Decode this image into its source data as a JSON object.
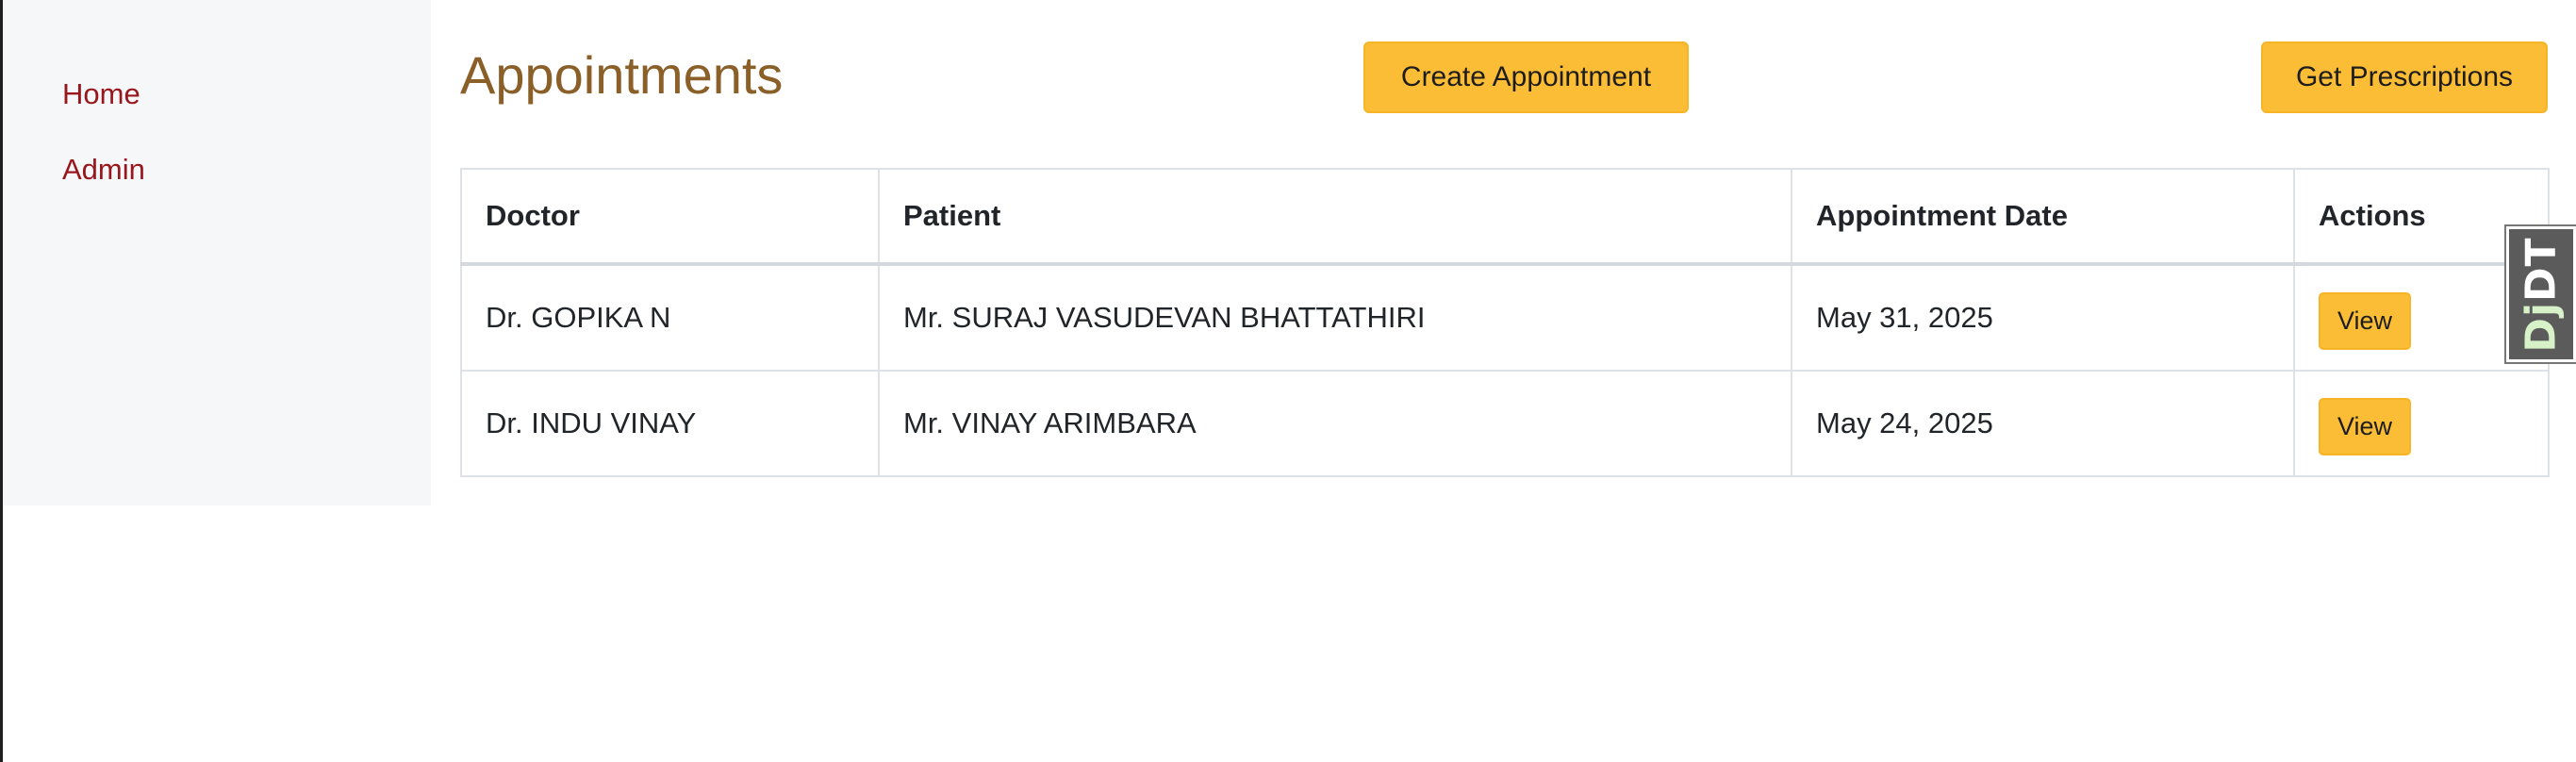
{
  "sidebar": {
    "items": [
      {
        "label": "Home"
      },
      {
        "label": "Admin"
      }
    ]
  },
  "main": {
    "title": "Appointments",
    "create_button": "Create Appointment",
    "prescriptions_button": "Get Prescriptions"
  },
  "table": {
    "headers": [
      "Doctor",
      "Patient",
      "Appointment Date",
      "Actions"
    ],
    "rows": [
      {
        "doctor": "Dr. GOPIKA N",
        "patient": "Mr. SURAJ VASUDEVAN BHATTATHIRI",
        "date": "May 31, 2025",
        "action": "View"
      },
      {
        "doctor": "Dr. INDU VINAY",
        "patient": "Mr. VINAY ARIMBARA",
        "date": "May 24, 2025",
        "action": "View"
      }
    ]
  },
  "debug_toolbar": {
    "handle_dj": "Dj",
    "handle_dt": "DT"
  },
  "colors": {
    "link": "#97171c",
    "title": "#8a5f28",
    "warning_button": "#fbbd36",
    "sidebar_bg": "#f6f7f9"
  }
}
